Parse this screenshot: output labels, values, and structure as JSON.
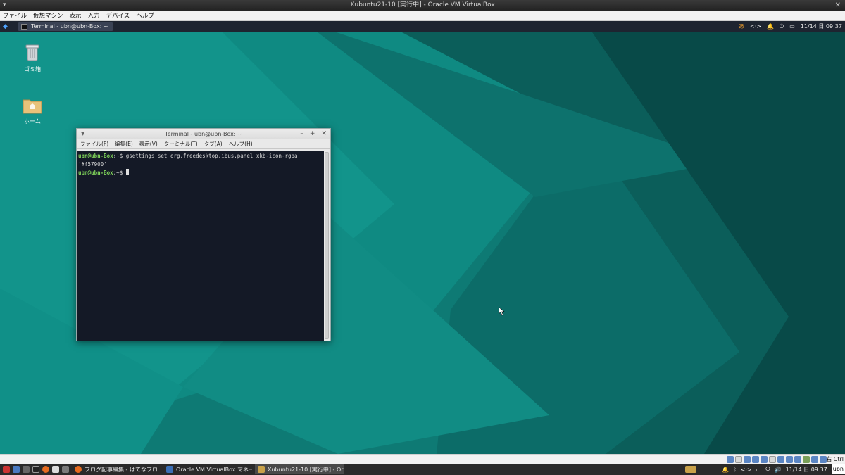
{
  "vbox": {
    "window_title": "Xubuntu21-10 [実行中] - Oracle VM VirtualBox",
    "menu": [
      "ファイル",
      "仮想マシン",
      "表示",
      "入力",
      "デバイス",
      "ヘルプ"
    ],
    "host_key": "右 Ctrl"
  },
  "guest_panel": {
    "task_label": "Terminal - ubn@ubn-Box: ~",
    "clock": "11/14 日 09:37"
  },
  "desktop": {
    "icons": [
      {
        "label": "ゴミ箱",
        "icon": "trash-icon"
      },
      {
        "label": "ホーム",
        "icon": "home-folder-icon"
      }
    ]
  },
  "terminal": {
    "title": "Terminal - ubn@ubn-Box: ~",
    "menu": [
      "ファイル(F)",
      "編集(E)",
      "表示(V)",
      "ターミナル(T)",
      "タブ(A)",
      "ヘルプ(H)"
    ],
    "lines": [
      {
        "prompt": "ubn@ubn-Box",
        "suffix": ":~$ ",
        "command": "gsettings set org.freedesktop.ibus.panel xkb-icon-rgba '#f57900'"
      },
      {
        "prompt": "ubn@ubn-Box",
        "suffix": ":~$ ",
        "command": ""
      }
    ]
  },
  "host_taskbar": {
    "tasks": [
      {
        "label": "ブログ記事編集 - はてなブロ...",
        "icon": "firefox-icon"
      },
      {
        "label": "Oracle VM VirtualBox マネー...",
        "icon": "virtualbox-icon"
      },
      {
        "label": "Xubuntu21-10 [実行中] - Ora...",
        "icon": "virtualbox-vm-icon"
      }
    ],
    "clock": "11/14 日 09:37",
    "show_desktop": "ubn"
  },
  "colors": {
    "desktop_teal": "#0e6663",
    "terminal_bg": "#141926",
    "prompt_green": "#7fd45a",
    "panel_dark": "#1e2430"
  }
}
